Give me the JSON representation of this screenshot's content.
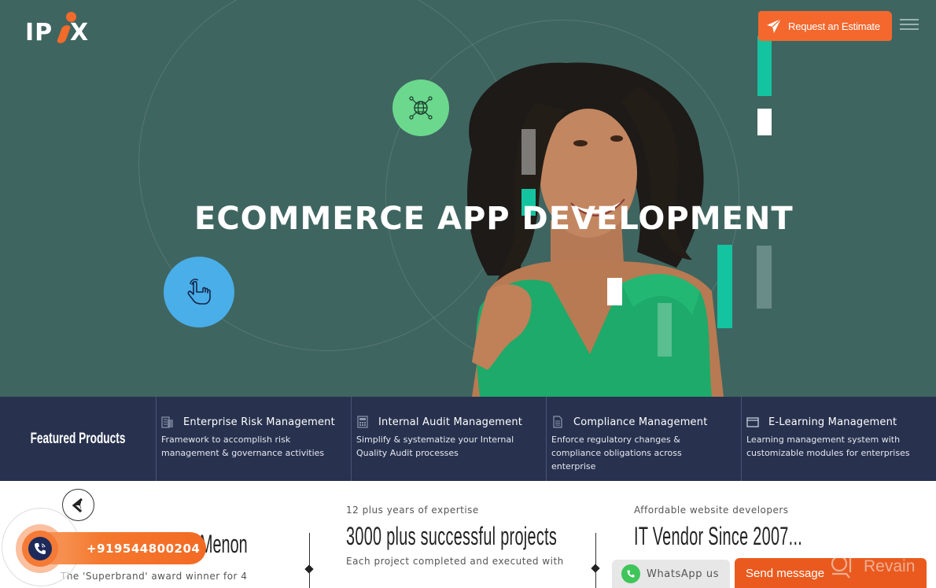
{
  "header": {
    "logo_text_left": "IP",
    "logo_text_right": "X",
    "estimate_label": "Request an Estimate",
    "estimate_icon": "paper-plane-icon",
    "menu_icon": "hamburger-menu-icon"
  },
  "hero": {
    "title": "ECOMMERCE APP DEVELOPMENT",
    "globe_icon": "globe-network-icon",
    "hand_icon": "pointer-hand-icon",
    "colors": {
      "background": "#3f6560",
      "accent_teal": "#14c4a0",
      "accent_orange": "#f4682e",
      "globe_circle": "#6bd88e",
      "hand_circle": "#4aaee8"
    }
  },
  "featured": {
    "label": "Featured Products",
    "products": [
      {
        "title": "Enterprise Risk Management",
        "description_lines": [
          "Framework to accomplish risk",
          "management & governance activities"
        ],
        "icon": "building-document-icon"
      },
      {
        "title": "Internal Audit Management",
        "description_lines": [
          "Simplify & systematize your Internal",
          "Quality Audit processes"
        ],
        "icon": "calculator-icon"
      },
      {
        "title": "Compliance Management",
        "description_lines": [
          "Enforce regulatory changes &",
          "compliance obligations across",
          "enterprise"
        ],
        "icon": "document-icon"
      },
      {
        "title": "E-Learning Management",
        "description_lines": [
          "Learning management system with",
          "customizable modules for enterprises"
        ],
        "icon": "browser-window-icon"
      }
    ]
  },
  "highlights": {
    "col0": {
      "big_fragment": "Menon",
      "description": "The 'Superbrand' award winner for 4"
    },
    "col1": {
      "subtitle": "12 plus years of expertise",
      "big": "3000 plus successful projects",
      "description": "Each project completed and executed with"
    },
    "col2": {
      "subtitle": "Affordable website developers",
      "big": "IT Vendor Since 2007..."
    }
  },
  "widgets": {
    "phone_number": "+919544800204",
    "whatsapp_label": "WhatsApp us",
    "send_message_label": "Send message",
    "revain_label": "Revain"
  }
}
